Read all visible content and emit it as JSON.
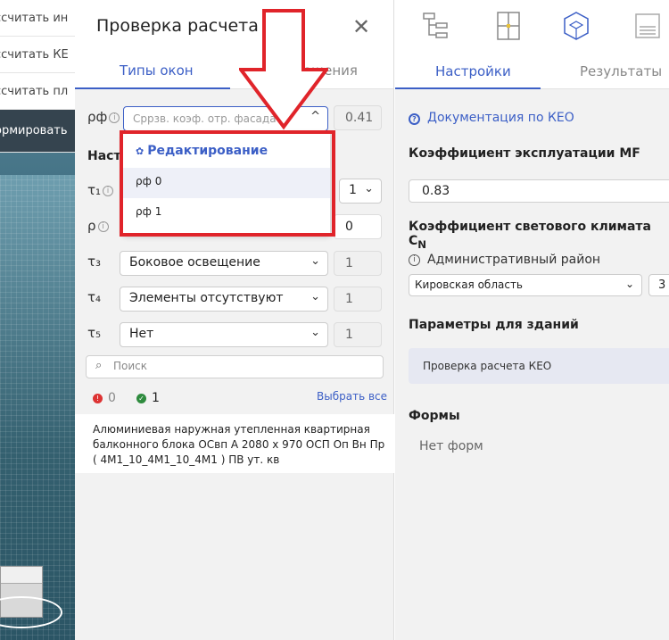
{
  "viewport": {
    "menu_items": [
      "ссчитать ин",
      "ссчитать КЕ",
      "ссчитать пл",
      "ормировать"
    ]
  },
  "panel": {
    "title": "Проверка расчета КЕО",
    "tabs": [
      "Типы окон",
      "Помещения"
    ],
    "rho_f": {
      "label": "ρф",
      "placeholder": "Сррзв. коэф. отр. фасада",
      "value": "0.41"
    },
    "section_label": "Настр",
    "rows": [
      {
        "label": "τ₁",
        "select": "",
        "value": "1"
      },
      {
        "label": "ρ",
        "select": "",
        "value": "0"
      },
      {
        "label": "τ₃",
        "select": "Боковое освещение",
        "value": "1"
      },
      {
        "label": "τ₄",
        "select": "Элементы отсутствуют",
        "value": "1"
      },
      {
        "label": "τ₅",
        "select": "Нет",
        "value": "1"
      }
    ],
    "search_placeholder": "Поиск",
    "errors_count": "0",
    "ok_count": "1",
    "select_all": "Выбрать все",
    "window_item": "Алюминиевая наружная утепленная квартирная балконного блока ОСвп А 2080 х 970 ОСП Оп Вн Пр ( 4М1_10_4М1_10_4М1 ) ПВ ут. кв"
  },
  "dropdown": {
    "header": "Редактирование",
    "options": [
      "ρф 0",
      "ρф 1"
    ]
  },
  "right": {
    "tabs": [
      "Настройки",
      "Результаты"
    ],
    "doc_link": "Документация по КЕО",
    "mf_label": "Коэффициент эксплуатации MF",
    "mf_value": "0.83",
    "cn_label": "Коэффициент светового климата C",
    "cn_sub": "N",
    "district_label": "Административный район",
    "region": "Кировская область",
    "region_num": "3",
    "building_params": "Параметры для зданий",
    "building_item": "Проверка расчета КЕО",
    "forms_label": "Формы",
    "no_forms": "Нет форм"
  },
  "colors": {
    "accent": "#3c5fc6",
    "highlight": "#e0242a"
  }
}
